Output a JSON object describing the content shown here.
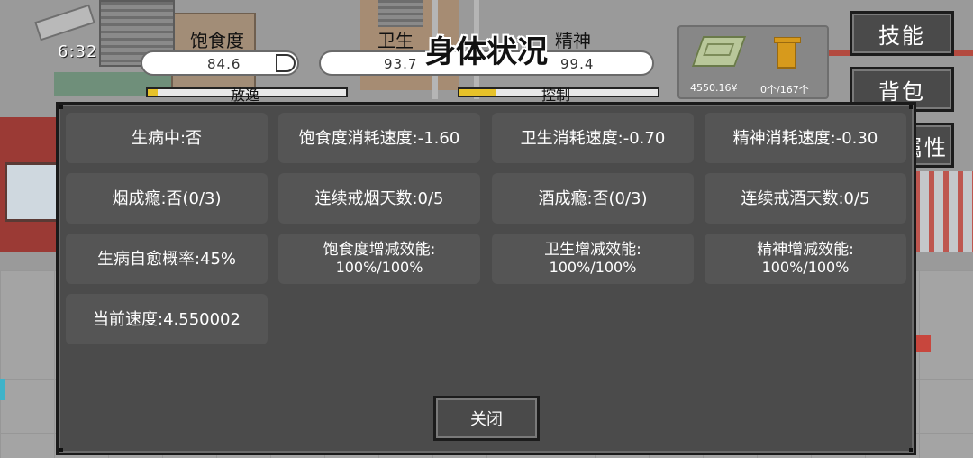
{
  "hud": {
    "clock": "6:32",
    "stats": [
      {
        "label": "饱食度",
        "value": "84.6"
      },
      {
        "label": "卫生",
        "value": "93.7"
      },
      {
        "label": "精神",
        "value": "99.4"
      }
    ],
    "status_bars": [
      {
        "label": "放逸",
        "fill": 0.05
      },
      {
        "label": "控制",
        "fill": 0.18
      }
    ],
    "money": "4550.16¥",
    "bag": "0个/167个",
    "icons": {
      "money": "cash-icon",
      "bag": "trash-bin-icon"
    }
  },
  "menu": {
    "skills": "技能",
    "backpack": "背包",
    "attributes_partial": "属性"
  },
  "dialog": {
    "title": "身体状况",
    "rows": [
      [
        "生病中:否",
        "饱食度消耗速度:-1.60",
        "卫生消耗速度:-0.70",
        "精神消耗速度:-0.30"
      ],
      [
        "烟成瘾:否(0/3)",
        "连续戒烟天数:0/5",
        "酒成瘾:否(0/3)",
        "连续戒酒天数:0/5"
      ],
      [
        "生病自愈概率:45%",
        "饱食度增减效能:",
        "卫生增减效能:",
        "精神增减效能:"
      ],
      [
        "当前速度:4.550002"
      ]
    ],
    "efficiency_values": [
      "100%/100%",
      "100%/100%",
      "100%/100%"
    ],
    "close": "关闭"
  },
  "colors": {
    "accent_yellow": "#e7c22a",
    "panel": "#4b4b4b",
    "cell": "#555555"
  }
}
